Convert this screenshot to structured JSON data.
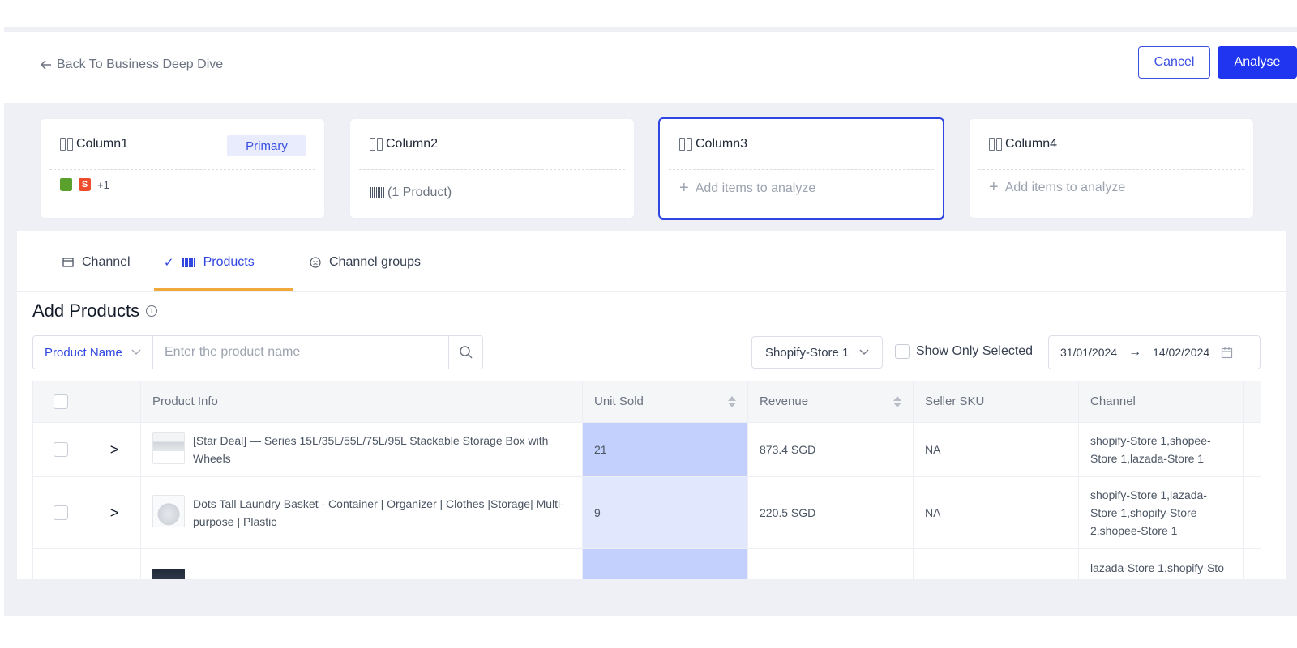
{
  "header": {
    "back_label": "Back To Business Deep Dive",
    "cancel_label": "Cancel",
    "analyse_label": "Analyse"
  },
  "columns": [
    {
      "title": "Column1",
      "badge": "Primary",
      "extra_count": "+1"
    },
    {
      "title": "Column2",
      "content": "(1 Product)"
    },
    {
      "title": "Column3",
      "content": "Add items to analyze"
    },
    {
      "title": "Column4",
      "content": "Add items to analyze"
    }
  ],
  "tabs": [
    {
      "label": "Channel",
      "icon": "store-icon"
    },
    {
      "label": "Products",
      "icon": "barcode-icon",
      "active": true
    },
    {
      "label": "Channel groups",
      "icon": "smiley-icon"
    }
  ],
  "section": {
    "title": "Add Products"
  },
  "filters": {
    "search_type": "Product Name",
    "search_placeholder": "Enter the product name",
    "store": "Shopify-Store 1",
    "show_only_selected": "Show Only Selected",
    "date_start": "31/01/2024",
    "date_end": "14/02/2024"
  },
  "table": {
    "columns": [
      "Product Info",
      "Unit Sold",
      "Revenue",
      "Seller SKU",
      "Channel"
    ],
    "rows": [
      {
        "product": "[Star Deal] — Series 15L/35L/55L/75L/95L Stackable Storage Box with Wheels",
        "unit_sold": "21",
        "revenue": "873.4 SGD",
        "seller_sku": "NA",
        "channel": "shopify-Store 1,shopee-Store 1,lazada-Store 1"
      },
      {
        "product": "Dots Tall Laundry Basket - Container | Organizer | Clothes |Storage| Multi-purpose | Plastic",
        "unit_sold": "9",
        "revenue": "220.5 SGD",
        "seller_sku": "NA",
        "channel": "shopify-Store 1,lazada-Store 1,shopify-Store 2,shopee-Store 1"
      },
      {
        "product": "",
        "unit_sold": "",
        "revenue": "",
        "seller_sku": "",
        "channel": "lazada-Store 1,shopify-Sto"
      }
    ]
  },
  "colors": {
    "accent": "#1f35f0",
    "tab_underline": "#f2a93b",
    "unit_sold_highlight_1": "#c3cffc",
    "unit_sold_highlight_2": "#e1e8fd"
  }
}
